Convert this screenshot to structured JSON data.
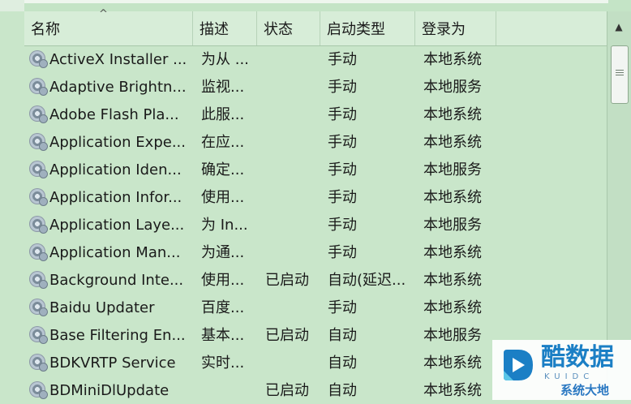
{
  "columns": {
    "name": "名称",
    "description": "描述",
    "status": "状态",
    "startup_type": "启动类型",
    "logon_as": "登录为"
  },
  "sort_indicator": "^",
  "services": [
    {
      "name": "ActiveX Installer ...",
      "description": "为从 ...",
      "status": "",
      "startup_type": "手动",
      "logon_as": "本地系统"
    },
    {
      "name": "Adaptive Brightn...",
      "description": "监视...",
      "status": "",
      "startup_type": "手动",
      "logon_as": "本地服务"
    },
    {
      "name": "Adobe Flash Pla...",
      "description": "此服...",
      "status": "",
      "startup_type": "手动",
      "logon_as": "本地系统"
    },
    {
      "name": "Application Expe...",
      "description": "在应...",
      "status": "",
      "startup_type": "手动",
      "logon_as": "本地系统"
    },
    {
      "name": "Application Iden...",
      "description": "确定...",
      "status": "",
      "startup_type": "手动",
      "logon_as": "本地服务"
    },
    {
      "name": "Application Infor...",
      "description": "使用...",
      "status": "",
      "startup_type": "手动",
      "logon_as": "本地系统"
    },
    {
      "name": "Application Laye...",
      "description": "为 In...",
      "status": "",
      "startup_type": "手动",
      "logon_as": "本地服务"
    },
    {
      "name": "Application Man...",
      "description": "为通...",
      "status": "",
      "startup_type": "手动",
      "logon_as": "本地系统"
    },
    {
      "name": "Background Inte...",
      "description": "使用...",
      "status": "已启动",
      "startup_type": "自动(延迟...",
      "logon_as": "本地系统"
    },
    {
      "name": "Baidu Updater",
      "description": "百度...",
      "status": "",
      "startup_type": "手动",
      "logon_as": "本地系统"
    },
    {
      "name": "Base Filtering En...",
      "description": "基本...",
      "status": "已启动",
      "startup_type": "自动",
      "logon_as": "本地服务"
    },
    {
      "name": "BDKVRTP Service",
      "description": "实时...",
      "status": "",
      "startup_type": "自动",
      "logon_as": "本地系统"
    },
    {
      "name": "BDMiniDlUpdate",
      "description": "",
      "status": "已启动",
      "startup_type": "自动",
      "logon_as": "本地系统"
    }
  ],
  "scrollbar": {
    "up_arrow": "▲"
  },
  "watermark": {
    "brand_name": "酷数据",
    "brand_sub": "KUIDC",
    "site_name": "系统大地"
  },
  "colors": {
    "background": "#c9e6ca",
    "watermark_blue": "#1b7fc5",
    "watermark_cyan": "#5bc6e8"
  }
}
